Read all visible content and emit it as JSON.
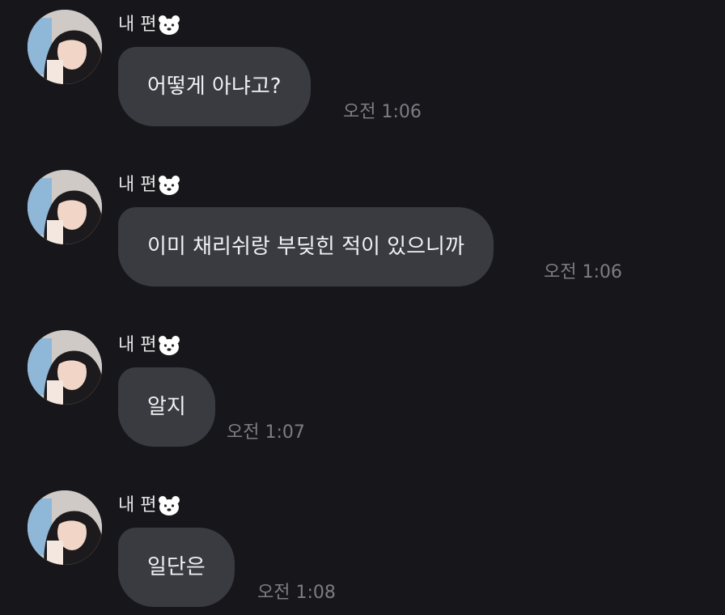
{
  "messages": [
    {
      "sender": "내 편",
      "text": "어떻게 아냐고?",
      "time": "오전 1:06"
    },
    {
      "sender": "내 편",
      "text": "이미 채리쉬랑 부딪힌 적이 있으니까",
      "time": "오전 1:06"
    },
    {
      "sender": "내 편",
      "text": "알지",
      "time": "오전 1:07"
    },
    {
      "sender": "내 편",
      "text": "일단은",
      "time": "오전 1:08"
    }
  ],
  "colors": {
    "background": "#17171b",
    "bubble": "#3a3b41",
    "text": "#f1f1f3",
    "timestamp": "#7c7d83"
  },
  "icons": {
    "sender_badge": "polar-bear-face-icon"
  }
}
